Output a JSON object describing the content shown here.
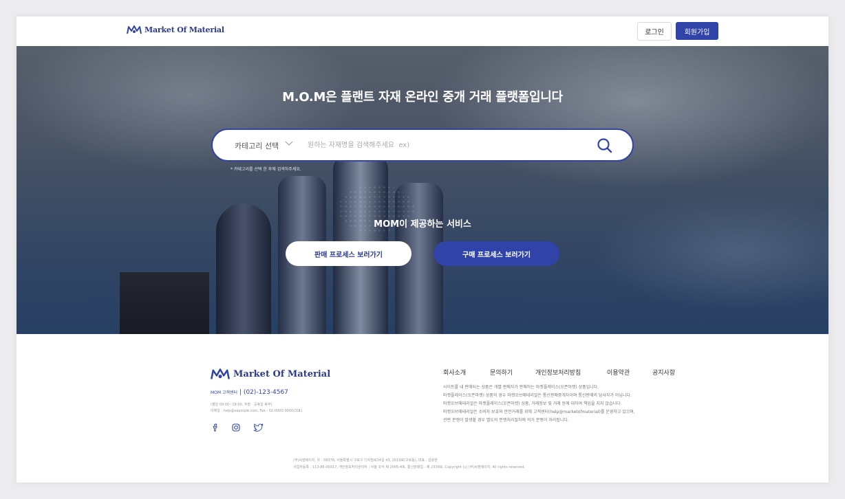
{
  "brand": {
    "name": "Market Of Material",
    "accent": "#2f43a8"
  },
  "header": {
    "login_label": "로그인",
    "signup_label": "회원가입"
  },
  "hero": {
    "title": "M.O.M은 플랜트 자재 온라인 중개 거래 플랫폼입니다",
    "search": {
      "category_label": "카테고리 선택",
      "placeholder": "원하는 자재명을 검색해주세요  ex)",
      "chevron_icon": "chevron-down-icon",
      "search_icon": "search-icon"
    },
    "hint": "* 카테고리를 선택 한 후에 검색하주세요.",
    "services_title": "MOM이 제공하는 서비스",
    "sale_button": "판매 프로세스 보러가기",
    "buy_button": "구매 프로세스 보러가기"
  },
  "footer": {
    "cs_label": "MOM 고객센터",
    "cs_phone": "| (02)-123-4567",
    "cs_hours": "(평일 09:00~18:00, 주말 · 공휴일 휴무)",
    "cs_contact": "이메일 : help@example.com, Fax : 02-0000-0000(대표)",
    "social": [
      "facebook-icon",
      "instagram-icon",
      "twitter-icon"
    ],
    "nav": [
      "회사소개",
      "문의하기",
      "개인정보처리방침",
      "이용약관",
      "공지사항"
    ],
    "desc": [
      "사이트를 내 판매되는 상품은 개별 판매자가 판매하는 마켓플레이스(오픈마켓) 상품입니다.",
      "마켓플레이스(오픈마켓) 상품의 경우 마켓오브메테리얼은 통신판매중개자이며 통신판매의 당사자가 아닙니다.",
      "마켓오브메테리얼은 마켓플레이스(오픈마켓) 상품, 거래정보 및 거래 등에 대하여 책임을 지지 않습니다.",
      "마켓오브메테리얼은 소비자 보호와 안전거래를 위해 고객센터(help@marketofmaterial)를 운영하고 있으며,",
      "관련 분쟁이 발생할 경우 별도의 분쟁처리절차에 의거 분쟁이 처리됩니다."
    ],
    "copyright": [
      "(주)씨엠에이치, 우 : 08378, 서울특별시 구로구 디지털로34길 43, 2019호(구로동), 대표 : 김용현",
      "사업자등록 : 113-86-00917, 개인정보처리관리자 : 서울 조익 제 2005-4호, 통신판매업 : 제 2339호, Copyright (c) (주)씨엠에이치. All rights reserved."
    ]
  }
}
